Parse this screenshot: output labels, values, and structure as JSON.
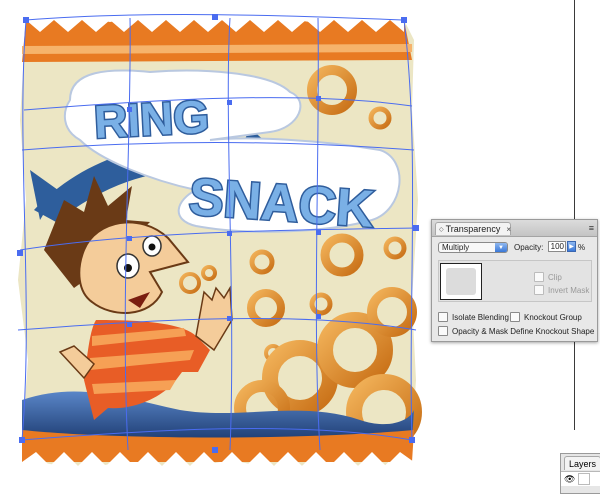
{
  "artwork": {
    "title_line1": "RING",
    "title_line2": "SNACK",
    "colors": {
      "background": "#ece6c4",
      "orange": "#e87a22",
      "blue": "#3b6fb0",
      "navy": "#23457a",
      "selection": "#4a6cf0",
      "skin": "#f4cc9a",
      "hair": "#6a3a16",
      "shirt": "#e85d26"
    }
  },
  "transparency_panel": {
    "tab_label": "Transparency",
    "tab_arrows_icon": "◇",
    "tab_close_icon": "×",
    "menu_icon": "≡",
    "blend_mode": "Multiply",
    "opacity_label": "Opacity:",
    "opacity_value": "100",
    "opacity_unit": "%",
    "clip_label": "Clip",
    "invert_mask_label": "Invert Mask",
    "isolate_blending_label": "Isolate Blending",
    "knockout_group_label": "Knockout Group",
    "opacity_mask_label": "Opacity & Mask Define Knockout Shape"
  },
  "layers_panel": {
    "tab_label": "Layers",
    "eye_icon": "👁"
  }
}
